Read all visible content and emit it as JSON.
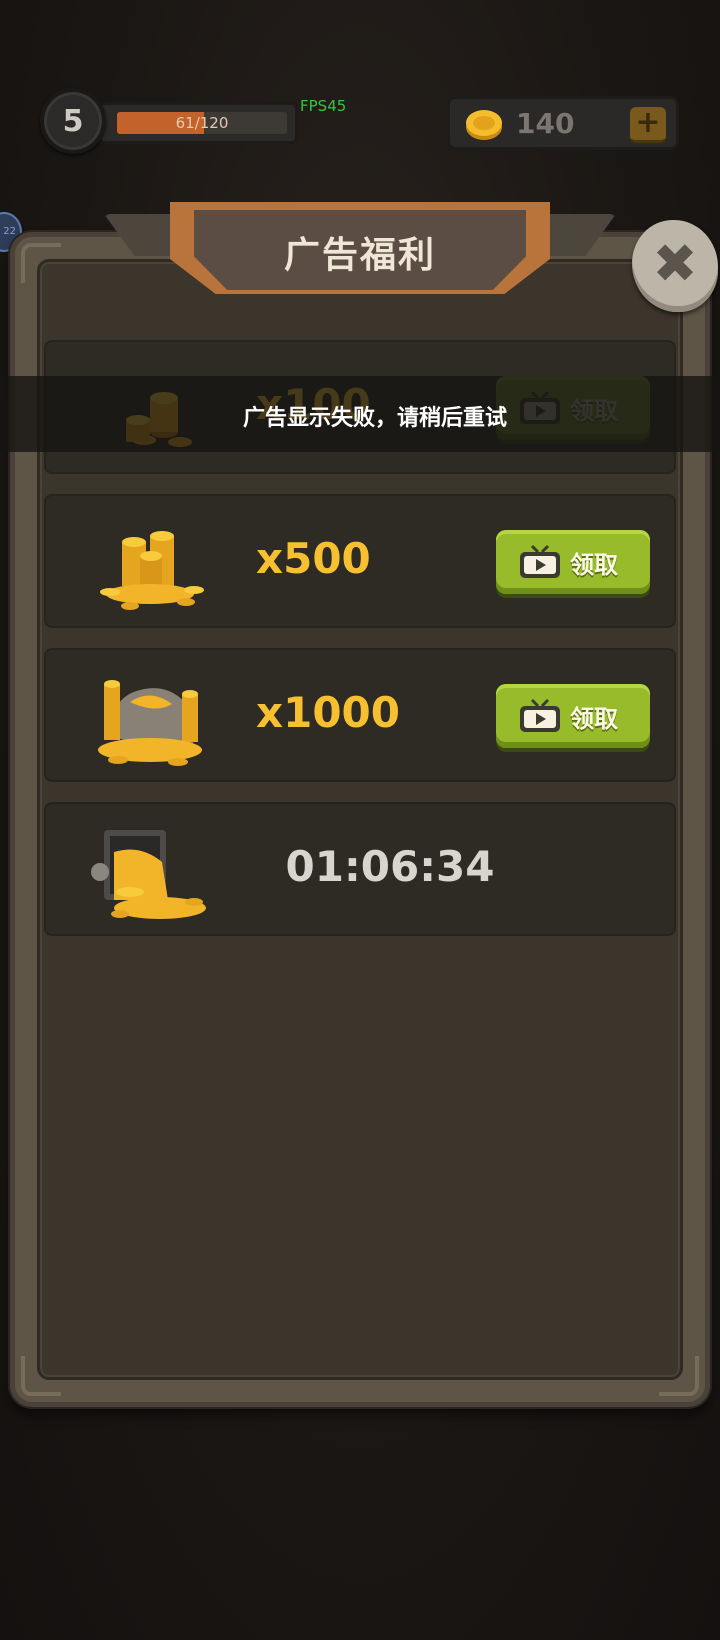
{
  "hud": {
    "level": "5",
    "xp_text": "61/120",
    "xp_progress": 0.51,
    "fps": "FPS45",
    "coins": "140",
    "plus": "+",
    "side_badge": "22"
  },
  "panel": {
    "title": "广告福利",
    "close": "✖"
  },
  "rewards": [
    {
      "amount": "x100",
      "button": "领取"
    },
    {
      "amount": "x500",
      "button": "领取"
    },
    {
      "amount": "x1000",
      "button": "领取"
    },
    {
      "timer": "01:06:34"
    }
  ],
  "toast": {
    "message": "广告显示失败，请稍后重试"
  },
  "colors": {
    "accent_gold": "#f7c030",
    "button_green": "#97bb2a",
    "xp_orange": "#c3622b",
    "fps_green": "#39c43d"
  }
}
